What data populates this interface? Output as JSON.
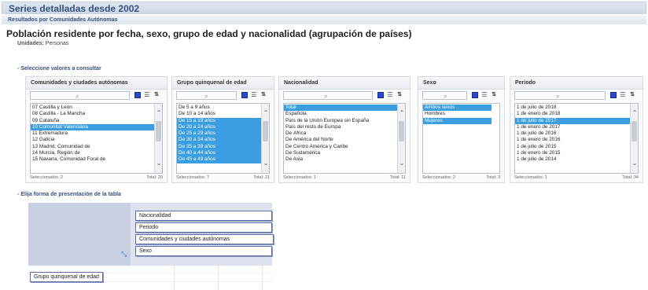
{
  "header": {
    "series_title": "Series detalladas desde 2002",
    "results_label": "Resultados por Comunidades Autónomas",
    "table_title": "Población residente por fecha, sexo, grupo de edad y nacionalidad (agrupación de países)",
    "units_label": "Unidades:",
    "units_value": "Personas"
  },
  "select_section": {
    "label": "Seleccione valores a consultar"
  },
  "panels": [
    {
      "title": "Comunidades y ciudades autónomas",
      "items": [
        {
          "label": "07 Castilla y León",
          "selected": false
        },
        {
          "label": "08 Castilla - La Mancha",
          "selected": false
        },
        {
          "label": "09 Cataluña",
          "selected": false
        },
        {
          "label": "10 Comunitat Valenciana",
          "selected": true
        },
        {
          "label": "11 Extremadura",
          "selected": false
        },
        {
          "label": "12 Galicia",
          "selected": false
        },
        {
          "label": "13 Madrid, Comunidad de",
          "selected": false
        },
        {
          "label": "14 Murcia, Región de",
          "selected": false
        },
        {
          "label": "15 Navarra, Comunidad Foral de",
          "selected": false
        }
      ],
      "footer_selected": "Seleccionados: 2",
      "footer_total": "Total: 20"
    },
    {
      "title": "Grupo quinquenal de edad",
      "items": [
        {
          "label": "De 5 a 9 años",
          "selected": false
        },
        {
          "label": "De 10 a 14 años",
          "selected": false
        },
        {
          "label": "De 15 a 19 años",
          "selected": true
        },
        {
          "label": "De 20 a 24 años",
          "selected": true
        },
        {
          "label": "De 25 a 29 años",
          "selected": true
        },
        {
          "label": "De 30 a 34 años",
          "selected": true
        },
        {
          "label": "De 35 a 39 años",
          "selected": true
        },
        {
          "label": "De 40 a 44 años",
          "selected": true
        },
        {
          "label": "De 45 a 49 años",
          "selected": true
        }
      ],
      "footer_selected": "Seleccionados: 7",
      "footer_total": "Total: 21"
    },
    {
      "title": "Nacionalidad",
      "items": [
        {
          "label": "Total",
          "selected": true
        },
        {
          "label": "Española",
          "selected": false
        },
        {
          "label": "País de la Unión Europea sin España",
          "selected": false
        },
        {
          "label": "País del resto de Europa",
          "selected": false
        },
        {
          "label": "De África",
          "selected": false
        },
        {
          "label": "De América del Norte",
          "selected": false
        },
        {
          "label": "De Centro América y Caribe",
          "selected": false
        },
        {
          "label": "De Sudamérica",
          "selected": false
        },
        {
          "label": "De Asia",
          "selected": false
        }
      ],
      "footer_selected": "Seleccionados: 1",
      "footer_total": "Total: 11"
    },
    {
      "title": "Sexo",
      "items": [
        {
          "label": "Ambos sexos",
          "selected": true
        },
        {
          "label": "Hombres",
          "selected": false
        },
        {
          "label": "Mujeres",
          "selected": true
        }
      ],
      "footer_selected": "Seleccionados: 2",
      "footer_total": "Total: 3"
    },
    {
      "title": "Periodo",
      "items": [
        {
          "label": "1 de julio de 2018",
          "selected": false
        },
        {
          "label": "1 de enero de 2018",
          "selected": false
        },
        {
          "label": "1 de julio de 2017",
          "selected": true
        },
        {
          "label": "1 de enero de 2017",
          "selected": false
        },
        {
          "label": "1 de julio de 2016",
          "selected": false
        },
        {
          "label": "1 de enero de 2016",
          "selected": false
        },
        {
          "label": "1 de julio de 2015",
          "selected": false
        },
        {
          "label": "1 de enero de 2015",
          "selected": false
        },
        {
          "label": "1 de julio de 2014",
          "selected": false
        }
      ],
      "footer_selected": "Seleccionados: 1",
      "footer_total": "Total: 34"
    }
  ],
  "layout_section": {
    "label": "Elija forma de presentación de la tabla",
    "column_dimensions": [
      "Nacionalidad",
      "Periodo",
      "Comunidades y ciudades autónomas",
      "Sexo"
    ],
    "row_dimensions": [
      "Grupo quinquenal de edad"
    ]
  },
  "colors": {
    "accent": "#34527f",
    "selection": "#3a9ee0",
    "select_all_icon": "#2b47c9"
  }
}
